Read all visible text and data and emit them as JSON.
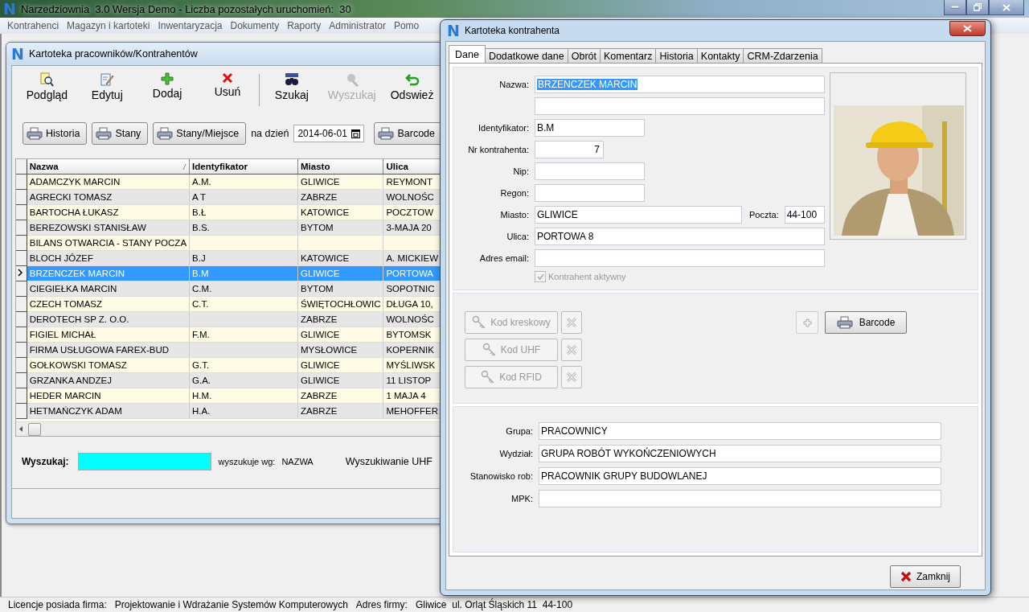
{
  "app": {
    "logo": "N",
    "title": "Narzedziownia  3.0 Wersja Demo - Liczba pozostałych uruchomień:  30"
  },
  "menu": [
    "Kontrahenci",
    "Magazyn i kartoteki",
    "Inwentaryzacja",
    "Dokumenty",
    "Raporty",
    "Administrator",
    "Pomo"
  ],
  "list_window": {
    "logo": "N",
    "title": "Kartoteka pracowników/Kontrahentów",
    "toolbar": [
      {
        "kind": "preview",
        "label": "Podgląd",
        "disabled": false
      },
      {
        "kind": "edit",
        "label": "Edytuj",
        "disabled": false
      },
      {
        "kind": "add",
        "label": "Dodaj",
        "disabled": false
      },
      {
        "kind": "delete",
        "label": "Usuń",
        "disabled": false
      },
      {
        "kind": "search",
        "label": "Szukaj",
        "disabled": false
      },
      {
        "kind": "find",
        "label": "Wyszukaj",
        "disabled": true
      },
      {
        "kind": "refresh",
        "label": "Odswież",
        "disabled": false
      }
    ],
    "print_buttons": [
      "Historia",
      "Stany",
      "Stany/Miejsce"
    ],
    "date_label": "na dzień",
    "date": "2014-06-01",
    "barcode_button": "Barcode",
    "columns": [
      "Nazwa",
      "Identyfikator",
      "Miasto",
      "Ulica"
    ],
    "rows": [
      {
        "cells": [
          "ADAMCZYK MARCIN",
          "A.M.",
          "GLIWICE",
          "REYMONT"
        ],
        "selected": false
      },
      {
        "cells": [
          "AGRECKI TOMASZ",
          "A T",
          "ZABRZE",
          "WOLNOŚC"
        ],
        "selected": false
      },
      {
        "cells": [
          "BARTOCHA ŁUKASZ",
          "B.Ł",
          "KATOWICE",
          "POCZTOW"
        ],
        "selected": false
      },
      {
        "cells": [
          "BEREZOWSKI STANISŁAW",
          "B.S.",
          "BYTOM",
          "3-MAJA 20"
        ],
        "selected": false
      },
      {
        "cells": [
          "BILANS OTWARCIA - STANY POCZA",
          "",
          "",
          ""
        ],
        "selected": false
      },
      {
        "cells": [
          "BLOCH JÓZEF",
          "B.J",
          "KATOWICE",
          "A. MICKIEW"
        ],
        "selected": false
      },
      {
        "cells": [
          "BRZENCZEK MARCIN",
          "B.M",
          "GLIWICE",
          "PORTOWA"
        ],
        "selected": true
      },
      {
        "cells": [
          "CIEGIEŁKA MARCIN",
          "C.M.",
          "BYTOM",
          "SOPOTNIC"
        ],
        "selected": false
      },
      {
        "cells": [
          "CZECH TOMASZ",
          "C.T.",
          "ŚWIĘTOCHŁOWIC",
          "DŁUGA 10,"
        ],
        "selected": false
      },
      {
        "cells": [
          "DEROTECH SP Z. O.O.",
          "",
          "ZABRZE",
          "WOLNOŚC"
        ],
        "selected": false
      },
      {
        "cells": [
          "FIGIEL MICHAŁ",
          "F.M.",
          "GLIWICE",
          "BYTOMSK"
        ],
        "selected": false
      },
      {
        "cells": [
          "FIRMA USŁUGOWA FAREX-BUD",
          "",
          "MYSŁOWICE",
          "KOPERNIK"
        ],
        "selected": false
      },
      {
        "cells": [
          "GOŁKOWSKI TOMASZ",
          "G.T.",
          "GLIWICE",
          "MYŚLIWSK"
        ],
        "selected": false
      },
      {
        "cells": [
          "GRZANKA ANDZEJ",
          "G.A.",
          "GLIWICE",
          "11 LISTOP"
        ],
        "selected": false
      },
      {
        "cells": [
          "HEDER MARCIN",
          "H.M.",
          "ZABRZE",
          "1 MAJA 4"
        ],
        "selected": false
      },
      {
        "cells": [
          "HETMAŃCZYK ADAM",
          "H.A.",
          "ZABRZE",
          "MEHOFFER"
        ],
        "selected": false
      }
    ],
    "search_label": "Wyszukaj:",
    "search_by_label": "wyszukuje wg:",
    "search_by": "NAZWA",
    "uhf_search": "Wyszukiwanie UHF"
  },
  "dialog": {
    "logo": "N",
    "title": "Kartoteka kontrahenta",
    "tabs": [
      {
        "label": "Dane",
        "selected": true
      },
      {
        "label": "Dodatkowe dane",
        "selected": false
      },
      {
        "label": "Obrót",
        "selected": false
      },
      {
        "label": "Komentarz",
        "selected": false
      },
      {
        "label": "Historia",
        "selected": false
      },
      {
        "label": "Kontakty",
        "selected": false
      },
      {
        "label": "CRM-Zdarzenia",
        "selected": false
      }
    ],
    "fields": [
      {
        "kind": "wide",
        "label": "Nazwa:",
        "value": "BRZENCZEK MARCIN",
        "highlighted": true
      },
      {
        "kind": "wide"
      },
      {
        "kind": "medium",
        "label": "Identyfikator:",
        "value": "B.M"
      },
      {
        "kind": "number",
        "label": "Nr kontrahenta:",
        "value": "7"
      },
      {
        "kind": "medium",
        "label": "Nip:"
      },
      {
        "kind": "medium",
        "label": "Regon:"
      },
      {
        "kind": "city",
        "label": "Miasto:",
        "value": "GLIWICE",
        "extra_label": "Poczta:",
        "extra_value": "44-100"
      },
      {
        "kind": "wide",
        "label": "Ulica:",
        "value": "PORTOWA 8"
      },
      {
        "kind": "wide",
        "label": "Adres email:"
      }
    ],
    "active_checkbox": {
      "label": "Kontrahent aktywny",
      "checked": true,
      "disabled": true
    },
    "code_buttons": [
      {
        "label": "Kod kreskowy",
        "disabled": true
      },
      {
        "label": "Kod UHF",
        "disabled": true
      },
      {
        "label": "Kod RFID",
        "disabled": true
      }
    ],
    "add_button_disabled": true,
    "barcode_button": "Barcode",
    "group_fields": [
      {
        "label": "Grupa:",
        "value": "PRACOWNICY"
      },
      {
        "label": "Wydział:",
        "value": "GRUPA ROBÓT WYKOŃCZENIOWYCH"
      },
      {
        "label": "Stanowisko rob:",
        "value": "PRACOWNIK GRUPY BUDOWLANEJ"
      },
      {
        "label": "MPK:"
      }
    ],
    "close_button": "Zamknij"
  },
  "status_bar": [
    "Licencje posiada firma:",
    "Projektowanie i Wdrażanie Systemów Komputerowych",
    "Adres firmy:",
    "Gliwice  ul. Orląt Śląskich 11  44-100"
  ]
}
